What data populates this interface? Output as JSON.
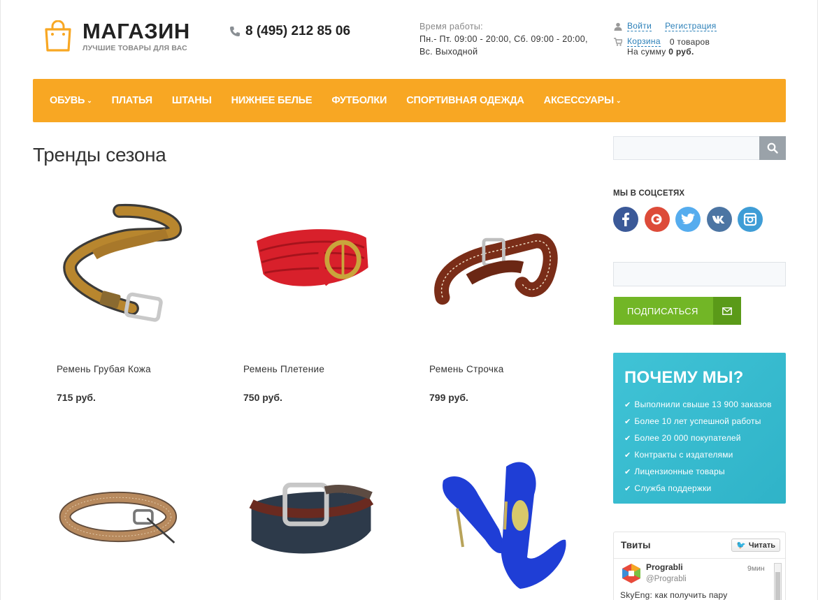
{
  "header": {
    "logo_name": "МАГАЗИН",
    "logo_tagline": "ЛУЧШИЕ ТОВАРЫ ДЛЯ ВАС",
    "phone": "8 (495) 212 85 06",
    "hours_label": "Время работы:",
    "hours_line1": "Пн.- Пт. 09:00 - 20:00, Сб. 09:00 - 20:00,",
    "hours_line2": "Вс. Выходной",
    "login": "Войти",
    "register": "Регистрация",
    "cart_link": "Корзина",
    "cart_count": "0 товаров",
    "cart_sum_label": "На сумму",
    "cart_sum_value": "0 руб."
  },
  "nav": {
    "items": [
      {
        "label": "ОБУВЬ",
        "dropdown": true
      },
      {
        "label": "ПЛАТЬЯ",
        "dropdown": false
      },
      {
        "label": "ШТАНЫ",
        "dropdown": false
      },
      {
        "label": "НИЖНЕЕ БЕЛЬЕ",
        "dropdown": false
      },
      {
        "label": "ФУТБОЛКИ",
        "dropdown": false
      },
      {
        "label": "СПОРТИВНАЯ ОДЕЖДА",
        "dropdown": false
      },
      {
        "label": "АКСЕССУАРЫ",
        "dropdown": true
      }
    ],
    "caret": "⌄"
  },
  "main": {
    "title": "Тренды сезона",
    "products": [
      {
        "name": "Ремень Грубая Кожа",
        "price": "715 руб."
      },
      {
        "name": "Ремень Плетение",
        "price": "750 руб."
      },
      {
        "name": "Ремень Строчка",
        "price": "799 руб."
      }
    ]
  },
  "sidebar": {
    "search_placeholder": "",
    "social_title": "МЫ В СОЦСЕТЯХ",
    "social": [
      {
        "icon": "facebook-icon",
        "glyph": "f",
        "color": "#3b5998"
      },
      {
        "icon": "google-plus-icon",
        "glyph": "g",
        "color": "#dd4b39"
      },
      {
        "icon": "twitter-icon",
        "glyph": "t",
        "color": "#55acee"
      },
      {
        "icon": "vk-icon",
        "glyph": "vk",
        "color": "#4c75a3"
      },
      {
        "icon": "instagram-icon",
        "glyph": "ig",
        "color": "#3f9dd6"
      }
    ],
    "subscribe_label": "ПОДПИСАТЬСЯ",
    "why_title": "ПОЧЕМУ МЫ?",
    "why_items": [
      "Выполнили свыше 13 900 заказов",
      "Более 10 лет успешной работы",
      "Более 20 000 покупателей",
      "Контракты с издателями",
      "Лицензионные товары",
      "Служба поддержки"
    ],
    "tweets": {
      "title": "Твиты",
      "follow": "Читать",
      "user": "Prograbli",
      "handle": "@Prograbli",
      "time": "9мин",
      "text": "SkyEng: как получить пару"
    }
  },
  "colors": {
    "nav": "#f8a723",
    "subscribe": "#72b626",
    "why_bg": "#38bbd0",
    "link": "#2a7fb8"
  }
}
